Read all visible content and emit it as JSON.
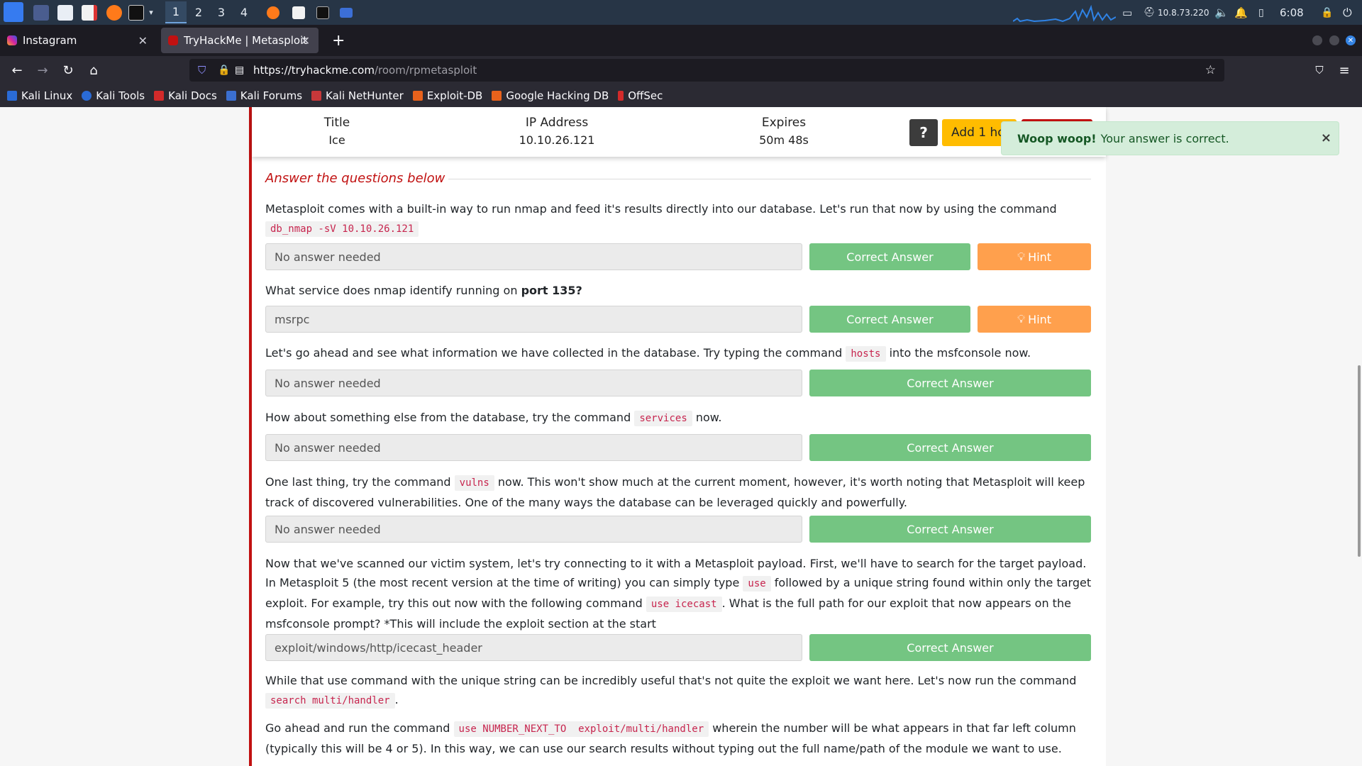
{
  "taskbar": {
    "workspaces": [
      "1",
      "2",
      "3",
      "4"
    ],
    "ip": "10.8.73.220",
    "time": "6:08"
  },
  "tabs": [
    {
      "label": "Instagram"
    },
    {
      "label": "TryHackMe | Metasploit"
    }
  ],
  "nav": {
    "url_host": "https://tryhackme.com",
    "url_path": "/room/rpmetasploit"
  },
  "bookmarks": [
    "Kali Linux",
    "Kali Tools",
    "Kali Docs",
    "Kali Forums",
    "Kali NetHunter",
    "Exploit-DB",
    "Google Hacking DB",
    "OffSec"
  ],
  "machine": {
    "title_label": "Title",
    "title_value": "Ice",
    "ip_label": "IP Address",
    "ip_value": "10.10.26.121",
    "expires_label": "Expires",
    "expires_value": "50m 48s",
    "help_label": "?",
    "add_hour_label": "Add 1 hour"
  },
  "toast": {
    "bold": "Woop woop!",
    "text": "Your answer is correct.",
    "close": "×"
  },
  "section": {
    "heading": "Answer the questions below"
  },
  "questions": [
    {
      "text_a": "Metasploit comes with a built-in way to run nmap and feed it's results directly into our database. Let's run that now by using the command",
      "code": "db_nmap -sV 10.10.26.121",
      "answer": "No answer needed",
      "button": "Correct Answer",
      "hint": "Hint"
    },
    {
      "text_a": "What service does nmap identify running on ",
      "bold": "port 135?",
      "answer": "msrpc",
      "button": "Correct Answer",
      "hint": "Hint"
    },
    {
      "text_a": "Let's go ahead and see what information we have collected in the database. Try typing the command",
      "code": "hosts",
      "text_b": "into the msfconsole now.",
      "answer": "No answer needed",
      "button": "Correct Answer"
    },
    {
      "text_a": "How about something else from the database, try the command",
      "code": "services",
      "text_b": "now.",
      "answer": "No answer needed",
      "button": "Correct Answer"
    },
    {
      "text_a": "One last thing, try the command",
      "code": "vulns",
      "text_b": "now. This won't show much at the current moment, however, it's worth noting that Metasploit will keep track of discovered vulnerabilities. One of the many ways the database can be leveraged quickly and powerfully.",
      "answer": "No answer needed",
      "button": "Correct Answer"
    },
    {
      "text_a": "Now that we've scanned our victim system, let's try connecting to it with a Metasploit payload. First, we'll have to search for the target payload. In Metasploit 5 (the most recent version at the time of writing) you can simply type",
      "code": "use",
      "text_b": "followed by a unique string found within only the target exploit. For example, try this out now with the following command",
      "code2": "use icecast",
      "text_c": ". What is the full path for our exploit that now appears on the msfconsole prompt? *This will include the exploit section at the start",
      "answer": "exploit/windows/http/icecast_header",
      "button": "Correct Answer"
    }
  ],
  "tail": [
    {
      "text_a": "While that use command with the unique string can be incredibly useful that's not quite the exploit we want here. Let's now run the command",
      "code": "search multi/handler",
      "text_b": "."
    },
    {
      "text_a": "Go ahead and run the command",
      "code": "use NUMBER_NEXT_TO  exploit/multi/handler",
      "text_b": "wherein the number will be what appears in that far left column (typically this will be 4 or 5). In this way, we can use our search results without typing out the full name/path of the module we want to use."
    }
  ]
}
